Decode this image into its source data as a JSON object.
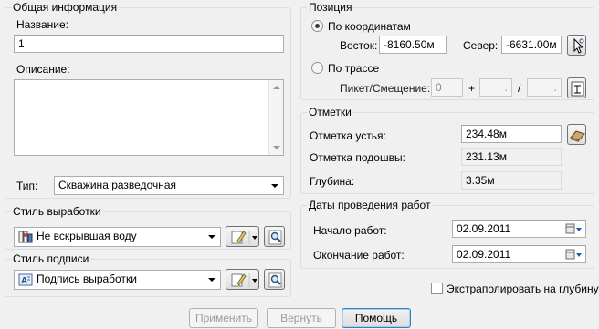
{
  "general": {
    "legend": "Общая информация",
    "name_label": "Название:",
    "name_value": "1",
    "description_label": "Описание:",
    "description_value": "",
    "type_label": "Тип:",
    "type_value": "Скважина разведочная"
  },
  "mining_style": {
    "legend": "Стиль выработки",
    "value": "Не вскрывшая воду"
  },
  "label_style": {
    "legend": "Стиль подписи",
    "value": "Подпись выработки"
  },
  "position": {
    "legend": "Позиция",
    "by_coords_label": "По координатам",
    "east_label": "Восток:",
    "east_value": "-8160.50м",
    "north_label": "Север:",
    "north_value": "-6631.00м",
    "by_route_label": "По трассе",
    "picket_label": "Пикет/Смещение:",
    "picket_value": "0",
    "plus_sign": "+",
    "slash_sign": "/",
    "offset_value": ".",
    "offset_value2": "."
  },
  "marks": {
    "legend": "Отметки",
    "collar_label": "Отметка устья:",
    "collar_value": "234.48м",
    "bottom_label": "Отметка подошвы:",
    "bottom_value": "231.13м",
    "depth_label": "Глубина:",
    "depth_value": "3.35м"
  },
  "dates": {
    "legend": "Даты проведения работ",
    "start_label": "Начало работ:",
    "start_value": "02.09.2011",
    "end_label": "Окончание работ:",
    "end_value": "02.09.2011"
  },
  "extrapolate_label": "Экстраполировать на глубину",
  "buttons": {
    "apply": "Применить",
    "revert": "Вернуть",
    "help": "Помощь"
  },
  "colors": {
    "group_border": "#d5dfe5",
    "default_button_border": "#3c7fb1"
  }
}
